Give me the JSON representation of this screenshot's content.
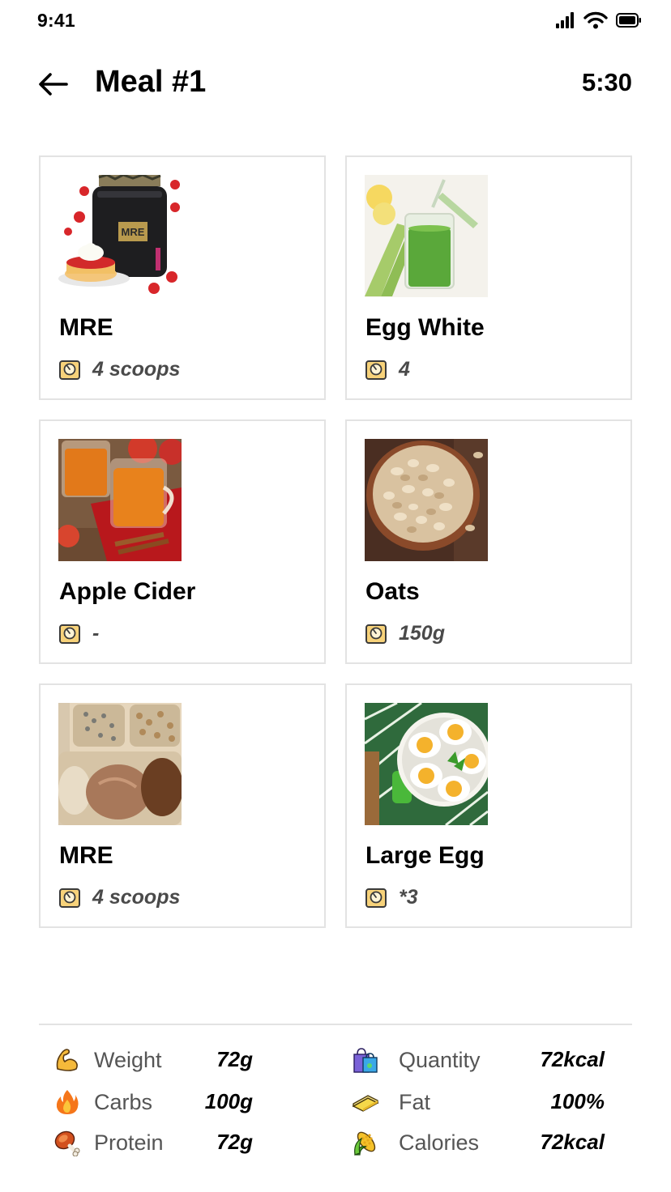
{
  "status_bar": {
    "time": "9:41"
  },
  "header": {
    "title": "Meal #1",
    "timer": "5:30"
  },
  "foods": [
    {
      "name": "MRE",
      "quantity": "4 scoops",
      "image": "protein-tub-photo"
    },
    {
      "name": "Egg White",
      "quantity": "4",
      "image": "green-juice-photo"
    },
    {
      "name": "Apple Cider",
      "quantity": "-",
      "image": "apple-cider-photo"
    },
    {
      "name": "Oats",
      "quantity": "150g",
      "image": "oats-bowl-photo"
    },
    {
      "name": "MRE",
      "quantity": "4 scoops",
      "image": "meal-tray-photo"
    },
    {
      "name": "Large Egg",
      "quantity": "*3",
      "image": "boiled-eggs-photo"
    }
  ],
  "summary": {
    "weight": {
      "label": "Weight",
      "value": "72g",
      "icon": "flexed-bicep-icon"
    },
    "carbs": {
      "label": "Carbs",
      "value": "100g",
      "icon": "fire-icon"
    },
    "protein": {
      "label": "Protein",
      "value": "72g",
      "icon": "meat-on-bone-icon"
    },
    "quantity": {
      "label": "Quantity",
      "value": "72kcal",
      "icon": "shopping-bags-icon"
    },
    "fat": {
      "label": "Fat",
      "value": "100%",
      "icon": "butter-icon"
    },
    "calories": {
      "label": "Calories",
      "value": "72kcal",
      "icon": "corn-icon"
    }
  },
  "colors": {
    "card_border": "#e3e3e3",
    "scale_icon": "#f7d27a",
    "text_muted": "#4a4a4a"
  }
}
